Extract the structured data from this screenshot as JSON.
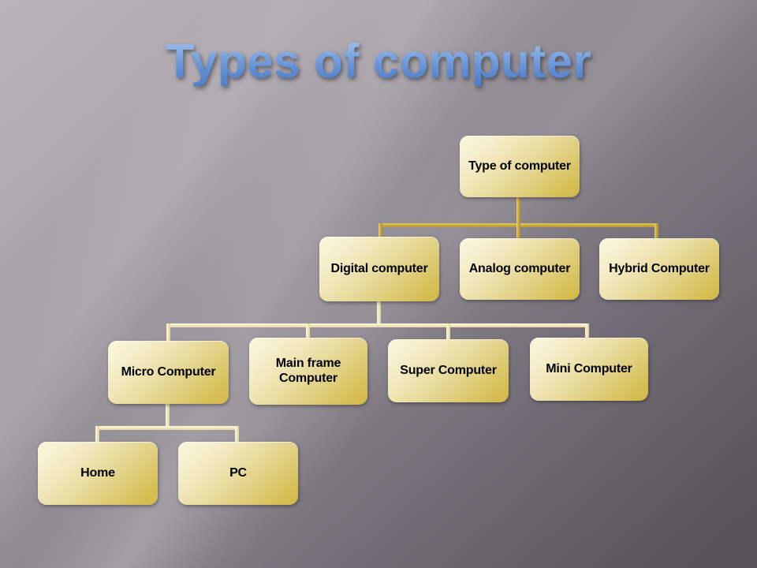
{
  "slide": {
    "title": "Types of computer",
    "title_color": "#6e9ede",
    "background_from": "#bab4ba",
    "background_to": "#585257"
  },
  "diagram": {
    "type": "org-chart",
    "node_fill_light": "#fbf6dd",
    "node_fill_dark": "#d2b847",
    "connector_gold": "#c9a838",
    "connector_cream": "#f0e6bc",
    "nodes": {
      "root": "Type of computer",
      "level2": [
        "Digital computer",
        "Analog computer",
        "Hybrid Computer"
      ],
      "level3": [
        "Micro Computer",
        "Main frame\nComputer",
        "Super Computer",
        "Mini Computer"
      ],
      "level4": [
        "Home",
        "PC"
      ]
    }
  }
}
